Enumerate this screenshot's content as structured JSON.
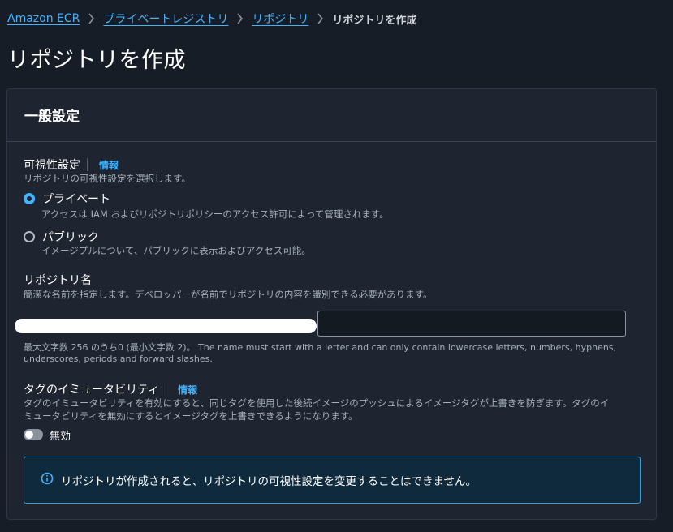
{
  "breadcrumb": {
    "items": [
      "Amazon ECR",
      "プライベートレジストリ",
      "リポジトリ"
    ],
    "current": "リポジトリを作成"
  },
  "page": {
    "title": "リポジトリを作成"
  },
  "panel": {
    "title": "一般設定",
    "visibility": {
      "label": "可視性設定",
      "info": "情報",
      "description": "リポジトリの可視性設定を選択します。",
      "options": [
        {
          "label": "プライベート",
          "description": "アクセスは IAM およびリポジトリポリシーのアクセス許可によって管理されます。",
          "selected": true
        },
        {
          "label": "パブリック",
          "description": "イメージプルについて、パブリックに表示およびアクセス可能。",
          "selected": false
        }
      ]
    },
    "repo_name": {
      "label": "リポジトリ名",
      "description": "簡潔な名前を指定します。デベロッパーが名前でリポジトリの内容を識別できる必要があります。",
      "value": "",
      "constraint_line1": "最大文字数 256 のうち0 (最小文字数 2)。 The name must start with a letter and can only contain lowercase letters, numbers, hyphens,",
      "constraint_line2": "underscores, periods and forward slashes."
    },
    "tag_immutability": {
      "label": "タグのイミュータビリティ",
      "info": "情報",
      "description_line1": "タグのイミュータビリティを有効にすると、同じタグを使用した後続イメージのプッシュによるイメージタグが上書きを防ぎます。タグのイ",
      "description_line2": "ミュータビリティを無効にするとイメージタグを上書きできるようになります。",
      "toggle_label": "無効",
      "enabled": false
    },
    "alert": {
      "text": "リポジトリが作成されると、リポジトリの可視性設定を変更することはできません。"
    }
  },
  "colors": {
    "background": "#161d26",
    "panel": "#1e2530",
    "link": "#42b4ff",
    "alert_border": "#3aa0d8"
  }
}
